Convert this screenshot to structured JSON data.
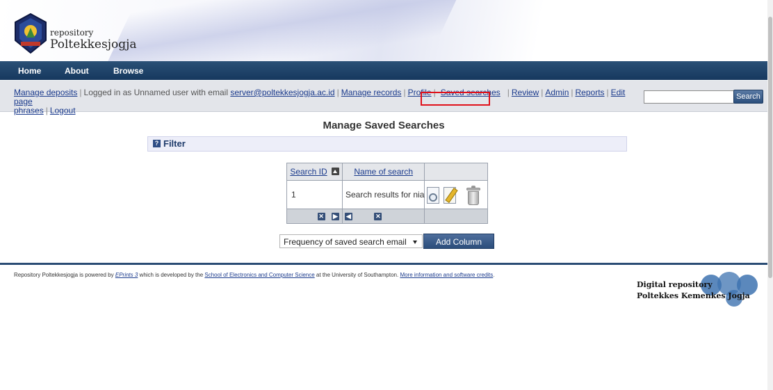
{
  "header": {
    "repo_small": "repository",
    "repo_name": "Poltekkesjogja"
  },
  "menu": [
    "Home",
    "About",
    "Browse"
  ],
  "toolbar": {
    "manage_deposits": "Manage deposits",
    "logged_in_prefix": "Logged in as Unnamed user with email",
    "email": "server@poltekkesjogja.ac.id",
    "manage_records": "Manage records",
    "profile": "Profile",
    "saved_searches": "Saved searches",
    "review": "Review",
    "admin": "Admin",
    "reports": "Reports",
    "edit_page": "Edit page",
    "phrases": "phrases",
    "logout": "Logout",
    "search_button": "Search",
    "search_value": ""
  },
  "page": {
    "title": "Manage Saved Searches",
    "filter_label": "Filter"
  },
  "table": {
    "headers": [
      "Search ID",
      "Name of search",
      ""
    ],
    "rows": [
      {
        "id": "1",
        "name": "Search results for nia"
      }
    ]
  },
  "controls": {
    "column_select_value": "Frequency of saved search email",
    "add_column_label": "Add Column"
  },
  "footer": {
    "t1": "Repository Poltekkesjogja is powered by ",
    "eprints": "EPrints 3",
    "t2": " which is developed by the ",
    "school": "School of Electronics and Computer Science",
    "t3": " at the University of Southampton. ",
    "more_info": "More information and software credits",
    "t4": ".",
    "logo_line1": "Digital repository",
    "logo_line2": "Poltekkes Kemenkes Jogja"
  }
}
